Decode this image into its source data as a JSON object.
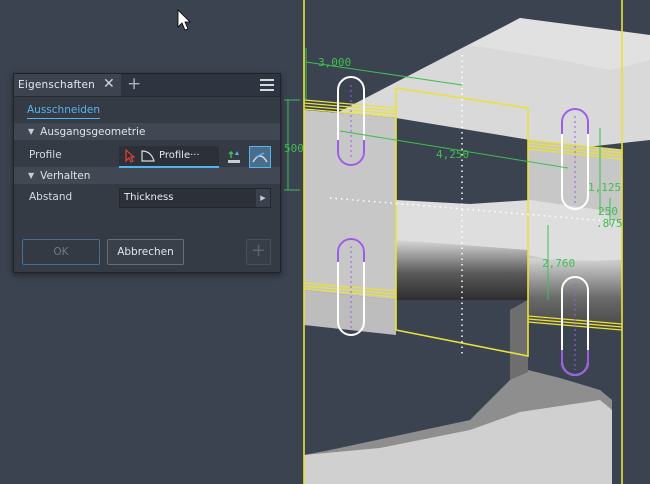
{
  "panel": {
    "tab_title": "Eigenschaften",
    "tab_close": "✕",
    "tab_add": "+",
    "subtab": "Ausschneiden",
    "section1": "Ausgangsgeometrie",
    "profile_label": "Profile",
    "profile_value": "Profile···",
    "section2": "Verhalten",
    "distance_label": "Abstand",
    "distance_value": "Thickness",
    "ok_label": "OK",
    "cancel_label": "Abbrechen",
    "plus_label": "+"
  },
  "dimensions": {
    "d1": "3,000",
    "d2": "500",
    "d3": "4,250",
    "d4": "1,125",
    "d5": "250",
    "d6": ".875",
    "d7": "2,760"
  },
  "colors": {
    "accent": "#55b3ef",
    "sketch_yellow": "#e8e23a",
    "slot_purple": "#9b5de5",
    "dimension_green": "#3fbf52",
    "background": "#3b4250"
  }
}
